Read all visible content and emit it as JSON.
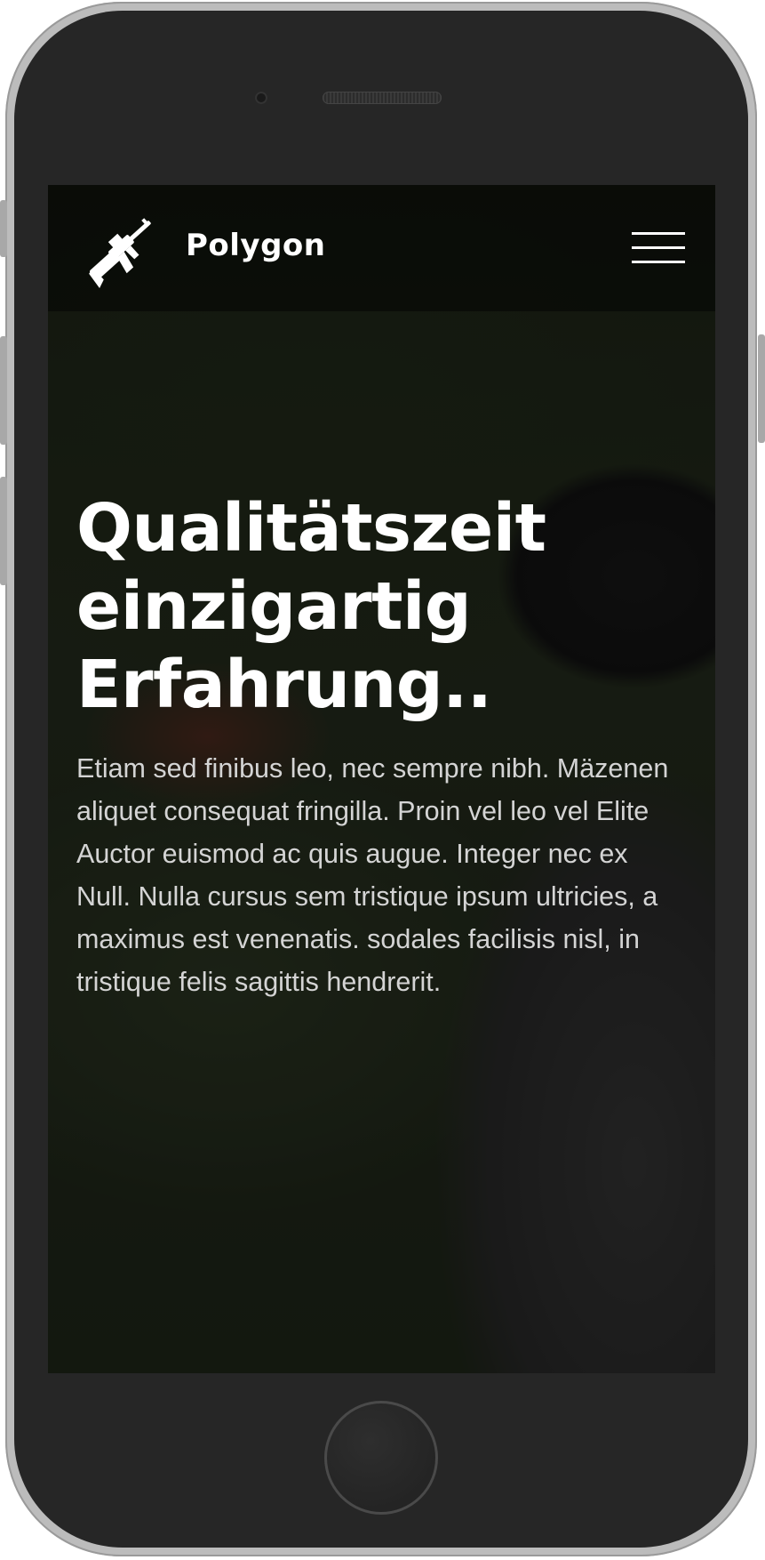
{
  "navbar": {
    "brand": "Polygon",
    "logo_icon": "rifle-icon",
    "menu_icon": "hamburger-menu-icon"
  },
  "hero": {
    "title_line1": "Qualitätszeit",
    "title_line2": "einzigartig",
    "title_line3": "Erfahrung..",
    "text": "Etiam sed finibus leo, nec sempre nibh. Mäzenen aliquet consequat fringilla. Proin vel leo vel Elite Auctor euismod ac quis augue. Integer nec ex Null. Nulla cursus sem tristique ipsum ultricies, a maximus est venenatis. sodales facilisis nisl, in tristique felis sagittis hendrerit."
  },
  "colors": {
    "text_primary": "#ffffff",
    "text_secondary": "#d4d4d4",
    "device_frame": "#262626"
  }
}
